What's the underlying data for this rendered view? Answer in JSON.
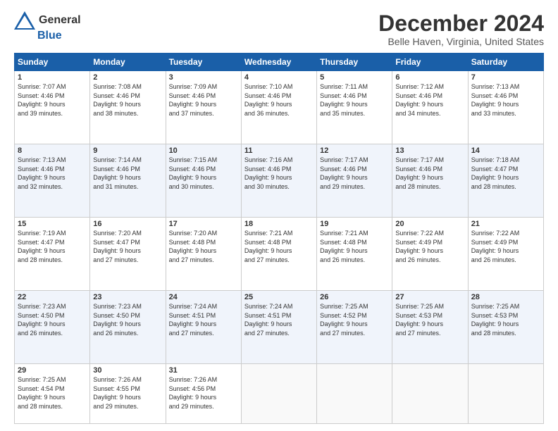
{
  "logo": {
    "general": "General",
    "blue": "Blue"
  },
  "header": {
    "month": "December 2024",
    "location": "Belle Haven, Virginia, United States"
  },
  "days_of_week": [
    "Sunday",
    "Monday",
    "Tuesday",
    "Wednesday",
    "Thursday",
    "Friday",
    "Saturday"
  ],
  "weeks": [
    [
      {
        "day": "1",
        "info": "Sunrise: 7:07 AM\nSunset: 4:46 PM\nDaylight: 9 hours\nand 39 minutes."
      },
      {
        "day": "2",
        "info": "Sunrise: 7:08 AM\nSunset: 4:46 PM\nDaylight: 9 hours\nand 38 minutes."
      },
      {
        "day": "3",
        "info": "Sunrise: 7:09 AM\nSunset: 4:46 PM\nDaylight: 9 hours\nand 37 minutes."
      },
      {
        "day": "4",
        "info": "Sunrise: 7:10 AM\nSunset: 4:46 PM\nDaylight: 9 hours\nand 36 minutes."
      },
      {
        "day": "5",
        "info": "Sunrise: 7:11 AM\nSunset: 4:46 PM\nDaylight: 9 hours\nand 35 minutes."
      },
      {
        "day": "6",
        "info": "Sunrise: 7:12 AM\nSunset: 4:46 PM\nDaylight: 9 hours\nand 34 minutes."
      },
      {
        "day": "7",
        "info": "Sunrise: 7:13 AM\nSunset: 4:46 PM\nDaylight: 9 hours\nand 33 minutes."
      }
    ],
    [
      {
        "day": "8",
        "info": "Sunrise: 7:13 AM\nSunset: 4:46 PM\nDaylight: 9 hours\nand 32 minutes."
      },
      {
        "day": "9",
        "info": "Sunrise: 7:14 AM\nSunset: 4:46 PM\nDaylight: 9 hours\nand 31 minutes."
      },
      {
        "day": "10",
        "info": "Sunrise: 7:15 AM\nSunset: 4:46 PM\nDaylight: 9 hours\nand 30 minutes."
      },
      {
        "day": "11",
        "info": "Sunrise: 7:16 AM\nSunset: 4:46 PM\nDaylight: 9 hours\nand 30 minutes."
      },
      {
        "day": "12",
        "info": "Sunrise: 7:17 AM\nSunset: 4:46 PM\nDaylight: 9 hours\nand 29 minutes."
      },
      {
        "day": "13",
        "info": "Sunrise: 7:17 AM\nSunset: 4:46 PM\nDaylight: 9 hours\nand 28 minutes."
      },
      {
        "day": "14",
        "info": "Sunrise: 7:18 AM\nSunset: 4:47 PM\nDaylight: 9 hours\nand 28 minutes."
      }
    ],
    [
      {
        "day": "15",
        "info": "Sunrise: 7:19 AM\nSunset: 4:47 PM\nDaylight: 9 hours\nand 28 minutes."
      },
      {
        "day": "16",
        "info": "Sunrise: 7:20 AM\nSunset: 4:47 PM\nDaylight: 9 hours\nand 27 minutes."
      },
      {
        "day": "17",
        "info": "Sunrise: 7:20 AM\nSunset: 4:48 PM\nDaylight: 9 hours\nand 27 minutes."
      },
      {
        "day": "18",
        "info": "Sunrise: 7:21 AM\nSunset: 4:48 PM\nDaylight: 9 hours\nand 27 minutes."
      },
      {
        "day": "19",
        "info": "Sunrise: 7:21 AM\nSunset: 4:48 PM\nDaylight: 9 hours\nand 26 minutes."
      },
      {
        "day": "20",
        "info": "Sunrise: 7:22 AM\nSunset: 4:49 PM\nDaylight: 9 hours\nand 26 minutes."
      },
      {
        "day": "21",
        "info": "Sunrise: 7:22 AM\nSunset: 4:49 PM\nDaylight: 9 hours\nand 26 minutes."
      }
    ],
    [
      {
        "day": "22",
        "info": "Sunrise: 7:23 AM\nSunset: 4:50 PM\nDaylight: 9 hours\nand 26 minutes."
      },
      {
        "day": "23",
        "info": "Sunrise: 7:23 AM\nSunset: 4:50 PM\nDaylight: 9 hours\nand 26 minutes."
      },
      {
        "day": "24",
        "info": "Sunrise: 7:24 AM\nSunset: 4:51 PM\nDaylight: 9 hours\nand 27 minutes."
      },
      {
        "day": "25",
        "info": "Sunrise: 7:24 AM\nSunset: 4:51 PM\nDaylight: 9 hours\nand 27 minutes."
      },
      {
        "day": "26",
        "info": "Sunrise: 7:25 AM\nSunset: 4:52 PM\nDaylight: 9 hours\nand 27 minutes."
      },
      {
        "day": "27",
        "info": "Sunrise: 7:25 AM\nSunset: 4:53 PM\nDaylight: 9 hours\nand 27 minutes."
      },
      {
        "day": "28",
        "info": "Sunrise: 7:25 AM\nSunset: 4:53 PM\nDaylight: 9 hours\nand 28 minutes."
      }
    ],
    [
      {
        "day": "29",
        "info": "Sunrise: 7:25 AM\nSunset: 4:54 PM\nDaylight: 9 hours\nand 28 minutes."
      },
      {
        "day": "30",
        "info": "Sunrise: 7:26 AM\nSunset: 4:55 PM\nDaylight: 9 hours\nand 29 minutes."
      },
      {
        "day": "31",
        "info": "Sunrise: 7:26 AM\nSunset: 4:56 PM\nDaylight: 9 hours\nand 29 minutes."
      },
      {
        "day": "",
        "info": ""
      },
      {
        "day": "",
        "info": ""
      },
      {
        "day": "",
        "info": ""
      },
      {
        "day": "",
        "info": ""
      }
    ]
  ]
}
